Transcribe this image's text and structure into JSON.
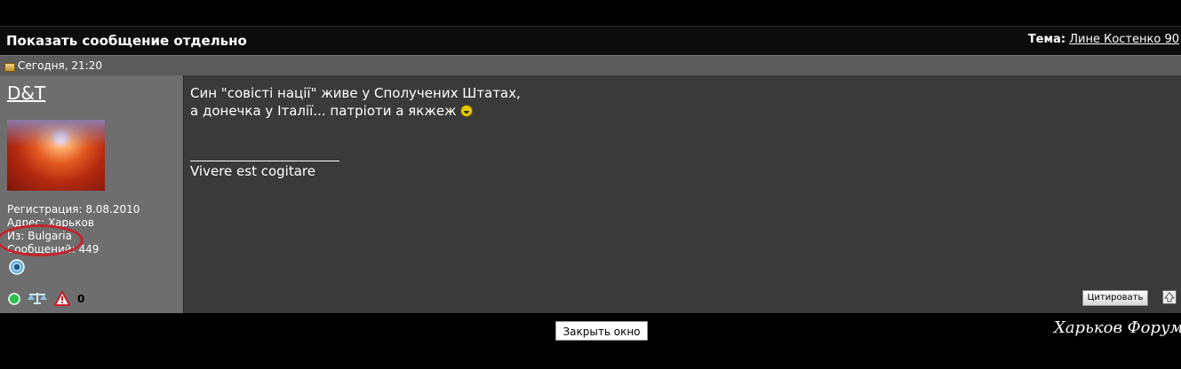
{
  "header": {
    "title": "Показать сообщение отдельно",
    "topic_label": "Тема:",
    "topic_link": "Лине Костенко 90"
  },
  "post": {
    "date": "Сегодня, 21:20",
    "message_line1": "Син \"совісті нації\" живе у Сполучених Штатах,",
    "message_line2": "а донечка у Італії... патріоти а якжеж",
    "smiley_icon": "laughing-smiley",
    "signature": "Vivere est cogitare",
    "quote_button": "Цитировать"
  },
  "user": {
    "name": "D&T",
    "registration": "Регистрация: 8.08.2010",
    "address": "Адрес: Харьков",
    "from": "Из: Bulgaria",
    "posts": "Сообщений: 449",
    "reputation_count": "0"
  },
  "footer": {
    "close_button": "Закрыть окно",
    "watermark": "Харьков Форум"
  },
  "colors": {
    "annotation_circle": "#c8202a",
    "user_panel_bg": "#6e6e6e",
    "post_bg": "#3a3a3a"
  }
}
